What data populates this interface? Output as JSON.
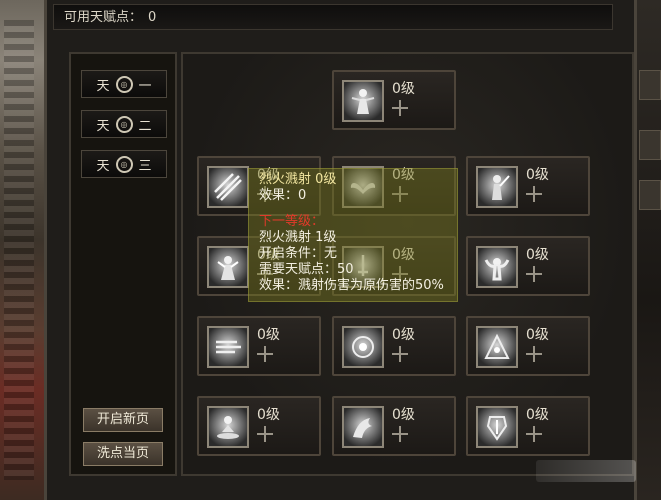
{
  "header": {
    "points_label": "可用天赋点：",
    "points_value": "0"
  },
  "pages": [
    {
      "char": "天",
      "num": "一"
    },
    {
      "char": "天",
      "num": "二"
    },
    {
      "char": "天",
      "num": "三"
    }
  ],
  "buttons": {
    "open_new": "开启新页",
    "reset": "洗点当页"
  },
  "skills": [
    {
      "id": "top",
      "level": "0级",
      "icon": "figure-icon"
    },
    {
      "id": "r1c1",
      "level": "0级",
      "icon": "slash-icon"
    },
    {
      "id": "r1c2",
      "level": "0级",
      "icon": "wings-icon"
    },
    {
      "id": "r1c3",
      "level": "0级",
      "icon": "warrior-icon"
    },
    {
      "id": "r2c1",
      "level": "0级",
      "icon": "mage-icon"
    },
    {
      "id": "r2c2",
      "level": "0级",
      "icon": "sword-icon"
    },
    {
      "id": "r2c3",
      "level": "0级",
      "icon": "flex-icon"
    },
    {
      "id": "r3c1",
      "level": "0级",
      "icon": "wind-icon"
    },
    {
      "id": "r3c2",
      "level": "0级",
      "icon": "orb-icon"
    },
    {
      "id": "r3c3",
      "level": "0级",
      "icon": "shrine-icon"
    },
    {
      "id": "r4c1",
      "level": "0级",
      "icon": "meditate-icon"
    },
    {
      "id": "r4c2",
      "level": "0级",
      "icon": "dragon-icon"
    },
    {
      "id": "r4c3",
      "level": "0级",
      "icon": "armor-icon"
    }
  ],
  "tooltip": {
    "name_line": "烈火溅射  0级",
    "effect_line": "效果：0",
    "next_header": "下一等级：",
    "next_name": "烈火溅射  1级",
    "req_line": "开启条件：无",
    "cost_line": "需要天赋点：50",
    "next_effect": "效果：溅射伤害为原伤害的50%"
  }
}
